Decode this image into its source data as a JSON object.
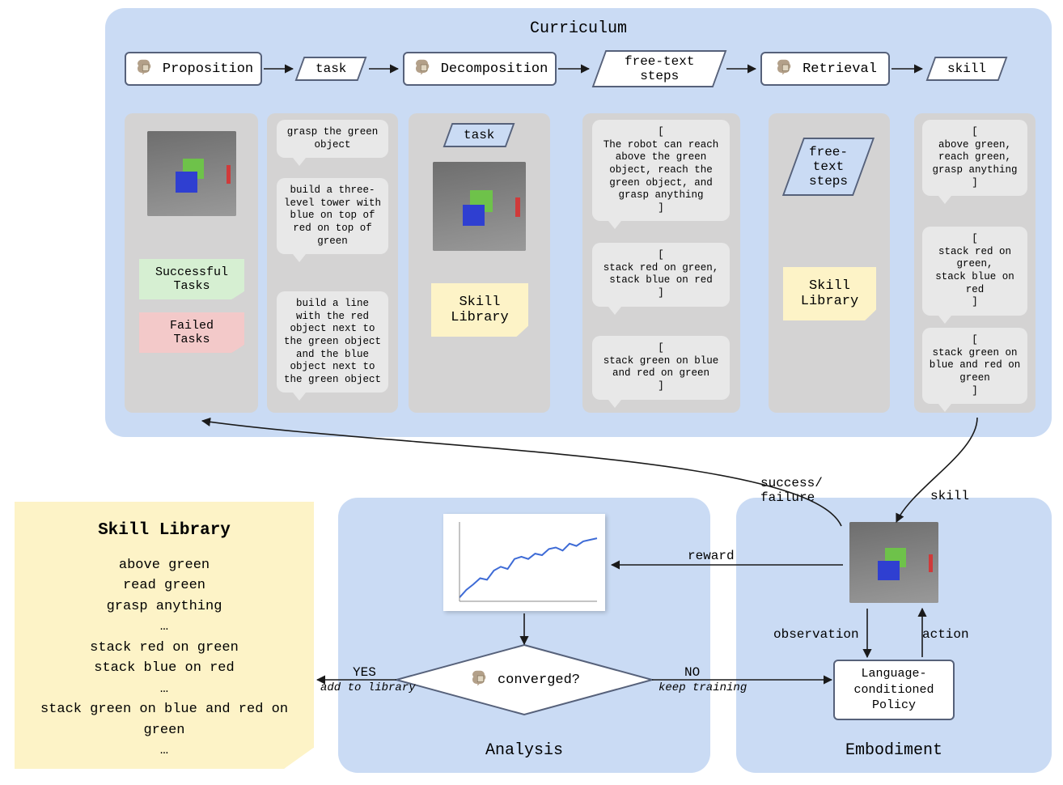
{
  "curriculum": {
    "title": "Curriculum",
    "proposition": {
      "label": "Proposition"
    },
    "task_flow": "task",
    "decomposition": {
      "label": "Decomposition"
    },
    "free_text_steps_flow": "free-text\nsteps",
    "retrieval": {
      "label": "Retrieval"
    },
    "skill_flow": "skill",
    "col1": {
      "success_label": "Successful\nTasks",
      "failed_label": "Failed\nTasks"
    },
    "col2_bubbles": [
      "grasp the green object",
      "build a three-level tower with blue on top of red on top of green",
      "build a line with the red object next to the green object and the blue object next to the green object"
    ],
    "col3": {
      "task_label": "task",
      "skill_library_label": "Skill\nLibrary"
    },
    "col4_bubbles": [
      "[\nThe robot can reach above the green object, reach the green object, and grasp anything\n]",
      "[\nstack red on green, stack blue on red\n]",
      "[\nstack green on blue and red on green\n]"
    ],
    "col5": {
      "free_text_label": "free-\ntext\nsteps",
      "skill_library_label": "Skill\nLibrary"
    },
    "col6_bubbles": [
      "[\nabove green, reach green, grasp anything\n]",
      "[\nstack red on green,\nstack blue on red\n]",
      "[\nstack green on blue and red on green\n]"
    ]
  },
  "analysis": {
    "title": "Analysis",
    "converged": "converged?",
    "yes": "YES",
    "yes_sub": "add to library",
    "no": "NO",
    "no_sub": "keep training",
    "reward": "reward"
  },
  "embodiment": {
    "title": "Embodiment",
    "success_failure": "success/\nfailure",
    "skill": "skill",
    "observation": "observation",
    "action": "action",
    "policy": "Language-\nconditioned\nPolicy"
  },
  "skill_library": {
    "title": "Skill Library",
    "items": [
      "above green",
      "read green",
      "grasp anything",
      "…",
      "stack red on green",
      "stack blue on red",
      "…",
      "stack green on blue and red on green",
      "…"
    ]
  },
  "chart_data": {
    "type": "line",
    "title": "",
    "xlabel": "",
    "ylabel": "reward",
    "xlim": [
      0,
      100
    ],
    "ylim": [
      0,
      1
    ],
    "x": [
      0,
      5,
      10,
      15,
      20,
      25,
      30,
      35,
      40,
      45,
      50,
      55,
      60,
      65,
      70,
      75,
      80,
      85,
      90,
      95,
      100
    ],
    "values": [
      0.05,
      0.15,
      0.22,
      0.3,
      0.28,
      0.4,
      0.45,
      0.42,
      0.55,
      0.58,
      0.55,
      0.62,
      0.6,
      0.68,
      0.7,
      0.66,
      0.75,
      0.72,
      0.78,
      0.8,
      0.82
    ]
  }
}
